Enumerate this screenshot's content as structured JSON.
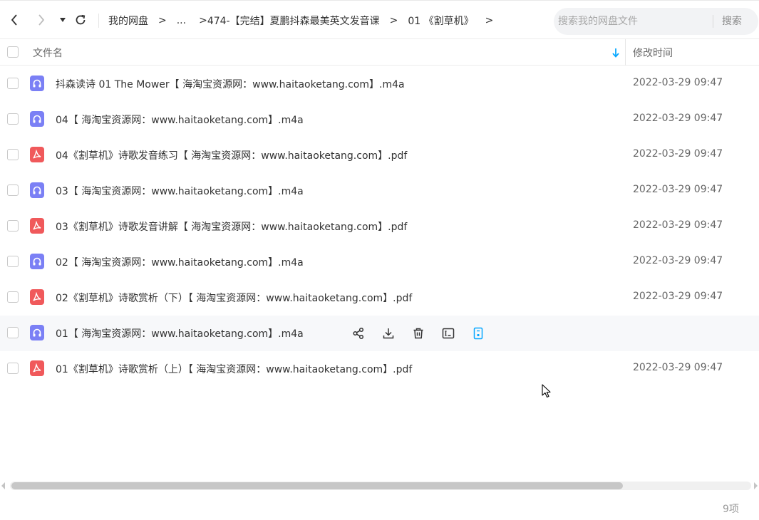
{
  "breadcrumb": {
    "items": [
      "我的网盘",
      "...",
      "474-【完结】夏鹏抖森最美英文发音课",
      "01 《割草机》"
    ],
    "separator": ">",
    "trailing_separator": ">"
  },
  "search": {
    "placeholder": "搜索我的网盘文件",
    "button_label": "搜索"
  },
  "table": {
    "col_name": "文件名",
    "col_modified": "修改时间",
    "sort_order": "descending",
    "rows": [
      {
        "name": "抖森读诗 01 The Mower【 海淘宝资源网：www.haitaoketang.com】.m4a",
        "type": "audio",
        "modified": "2022-03-29 09:47"
      },
      {
        "name": "04【 海淘宝资源网：www.haitaoketang.com】.m4a",
        "type": "audio",
        "modified": "2022-03-29 09:47"
      },
      {
        "name": "04《割草机》诗歌发音练习【 海淘宝资源网：www.haitaoketang.com】.pdf",
        "type": "pdf",
        "modified": "2022-03-29 09:47"
      },
      {
        "name": "03【 海淘宝资源网：www.haitaoketang.com】.m4a",
        "type": "audio",
        "modified": "2022-03-29 09:47"
      },
      {
        "name": "03《割草机》诗歌发音讲解【 海淘宝资源网：www.haitaoketang.com】.pdf",
        "type": "pdf",
        "modified": "2022-03-29 09:47"
      },
      {
        "name": "02【 海淘宝资源网：www.haitaoketang.com】.m4a",
        "type": "audio",
        "modified": "2022-03-29 09:47"
      },
      {
        "name": "02《割草机》诗歌赏析（下）【 海淘宝资源网：www.haitaoketang.com】.pdf",
        "type": "pdf",
        "modified": "2022-03-29 09:47"
      },
      {
        "name": "01【 海淘宝资源网：www.haitaoketang.com】.m4a",
        "type": "audio",
        "modified": ""
      },
      {
        "name": "01《割草机》诗歌赏析（上）【 海淘宝资源网：www.haitaoketang.com】.pdf",
        "type": "pdf",
        "modified": "2022-03-29 09:47"
      }
    ]
  },
  "hovered_row_actions": [
    "share-icon",
    "download-icon",
    "delete-icon",
    "rename-icon",
    "more-icon"
  ],
  "footer": {
    "item_count": "9项"
  },
  "colors": {
    "audio_icon": "#7b80f5",
    "pdf_icon": "#f0595b",
    "accent": "#06a7ff",
    "hover_row": "#f7f8fa"
  }
}
